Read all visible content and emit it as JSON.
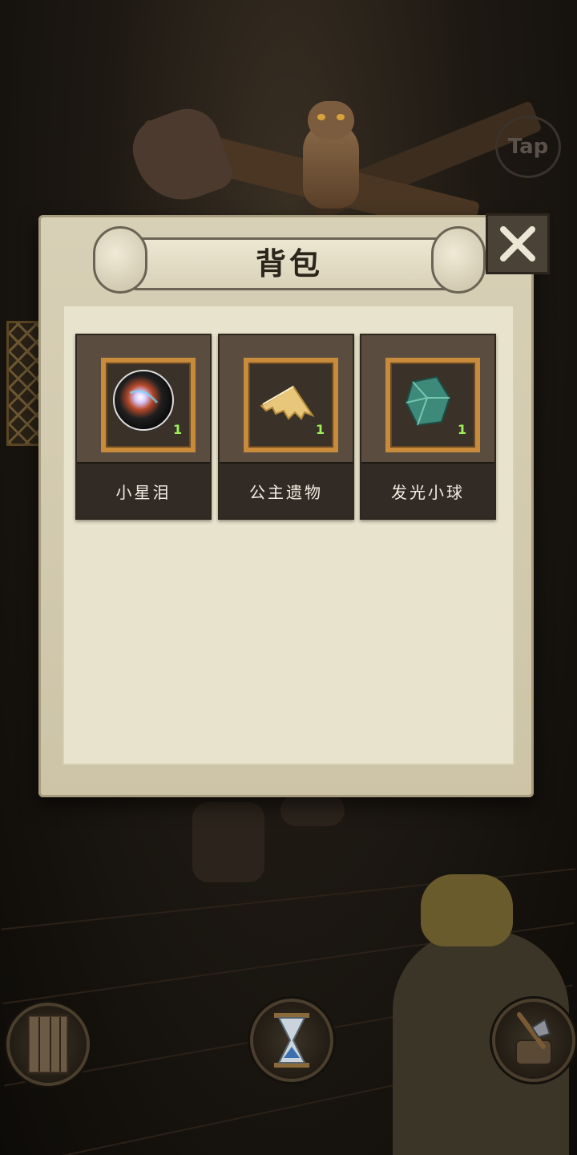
{
  "hud": {
    "tap_label": "Tap",
    "buttons": [
      {
        "name": "door-icon"
      },
      {
        "name": "hourglass-icon"
      },
      {
        "name": "axe-icon"
      }
    ]
  },
  "dialog": {
    "title": "背包",
    "close_icon": "close-icon",
    "items": [
      {
        "name": "小星泪",
        "count": "1",
        "icon": "star-tear-orb-icon",
        "color": "#0a0a0a"
      },
      {
        "name": "公主遗物",
        "count": "1",
        "icon": "princess-relic-cloth-icon",
        "color": "#e9c77a"
      },
      {
        "name": "发光小球",
        "count": "1",
        "icon": "glowing-gem-icon",
        "color": "#3d8a7a"
      }
    ]
  },
  "colors": {
    "panel": "#d8d0b6",
    "frame": "#c88a3b",
    "count": "#9cf05a"
  }
}
